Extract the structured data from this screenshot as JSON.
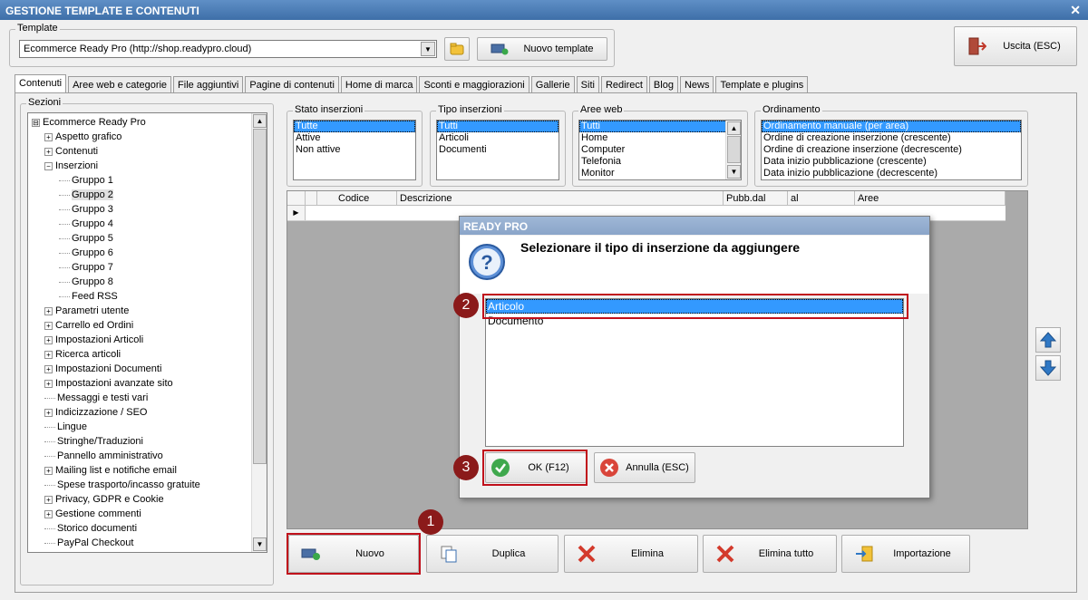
{
  "window": {
    "title": "GESTIONE TEMPLATE E CONTENUTI",
    "close": "✕"
  },
  "template": {
    "legend": "Template",
    "selected": "Ecommerce Ready Pro (http://shop.readypro.cloud)",
    "new_label": "Nuovo template"
  },
  "exit_label": "Uscita (ESC)",
  "tabs": [
    "Contenuti",
    "Aree web e categorie",
    "File aggiuntivi",
    "Pagine di contenuti",
    "Home di marca",
    "Sconti e maggiorazioni",
    "Gallerie",
    "Siti",
    "Redirect",
    "Blog",
    "News",
    "Template e plugins"
  ],
  "sections": {
    "legend": "Sezioni",
    "items": [
      {
        "label": "Ecommerce Ready Pro",
        "level": 0,
        "exp": "⊟"
      },
      {
        "label": "Aspetto grafico",
        "level": 1,
        "exp": "+"
      },
      {
        "label": "Contenuti",
        "level": 1,
        "exp": "+"
      },
      {
        "label": "Inserzioni",
        "level": 1,
        "exp": "−"
      },
      {
        "label": "Gruppo 1",
        "level": 2,
        "exp": ""
      },
      {
        "label": "Gruppo 2",
        "level": 2,
        "exp": "",
        "selected": true
      },
      {
        "label": "Gruppo 3",
        "level": 2,
        "exp": ""
      },
      {
        "label": "Gruppo 4",
        "level": 2,
        "exp": ""
      },
      {
        "label": "Gruppo 5",
        "level": 2,
        "exp": ""
      },
      {
        "label": "Gruppo 6",
        "level": 2,
        "exp": ""
      },
      {
        "label": "Gruppo 7",
        "level": 2,
        "exp": ""
      },
      {
        "label": "Gruppo 8",
        "level": 2,
        "exp": ""
      },
      {
        "label": "Feed RSS",
        "level": 2,
        "exp": ""
      },
      {
        "label": "Parametri utente",
        "level": 1,
        "exp": "+"
      },
      {
        "label": "Carrello ed Ordini",
        "level": 1,
        "exp": "+"
      },
      {
        "label": "Impostazioni Articoli",
        "level": 1,
        "exp": "+"
      },
      {
        "label": "Ricerca articoli",
        "level": 1,
        "exp": "+"
      },
      {
        "label": "Impostazioni Documenti",
        "level": 1,
        "exp": "+"
      },
      {
        "label": "Impostazioni avanzate sito",
        "level": 1,
        "exp": "+"
      },
      {
        "label": "Messaggi e testi vari",
        "level": 1,
        "exp": ""
      },
      {
        "label": "Indicizzazione / SEO",
        "level": 1,
        "exp": "+"
      },
      {
        "label": "Lingue",
        "level": 1,
        "exp": ""
      },
      {
        "label": "Stringhe/Traduzioni",
        "level": 1,
        "exp": ""
      },
      {
        "label": "Pannello amministrativo",
        "level": 1,
        "exp": ""
      },
      {
        "label": "Mailing list e notifiche email",
        "level": 1,
        "exp": "+"
      },
      {
        "label": "Spese trasporto/incasso gratuite",
        "level": 1,
        "exp": ""
      },
      {
        "label": "Privacy, GDPR e Cookie",
        "level": 1,
        "exp": "+"
      },
      {
        "label": "Gestione commenti",
        "level": 1,
        "exp": "+"
      },
      {
        "label": "Storico documenti",
        "level": 1,
        "exp": ""
      },
      {
        "label": "PayPal Checkout",
        "level": 1,
        "exp": ""
      }
    ]
  },
  "filters": {
    "stato": {
      "legend": "Stato inserzioni",
      "items": [
        "Tutte",
        "Attive",
        "Non attive"
      ]
    },
    "tipo": {
      "legend": "Tipo inserzioni",
      "items": [
        "Tutti",
        "Articoli",
        "Documenti"
      ]
    },
    "aree": {
      "legend": "Aree web",
      "items": [
        "Tutti",
        "Home",
        "Computer",
        "Telefonia",
        "Monitor"
      ]
    },
    "ordinamento": {
      "legend": "Ordinamento",
      "items": [
        "Ordinamento manuale (per area)",
        "Ordine di creazione inserzione (crescente)",
        "Ordine di creazione inserzione (decrescente)",
        "Data inizio pubblicazione (crescente)",
        "Data inizio pubblicazione (decrescente)"
      ]
    }
  },
  "grid": {
    "columns": [
      "Codice",
      "Descrizione",
      "Pubb.dal",
      "al",
      "Aree"
    ]
  },
  "dialog": {
    "title": "READY PRO",
    "question": "Selezionare il tipo di inserzione da aggiungere",
    "options": [
      "Articolo",
      "Documento"
    ],
    "ok_label": "OK (F12)",
    "cancel_label": "Annulla (ESC)"
  },
  "actions": {
    "nuovo": "Nuovo",
    "duplica": "Duplica",
    "elimina": "Elimina",
    "elimina_tutto": "Elimina tutto",
    "importazione": "Importazione"
  },
  "callouts": [
    "1",
    "2",
    "3"
  ]
}
